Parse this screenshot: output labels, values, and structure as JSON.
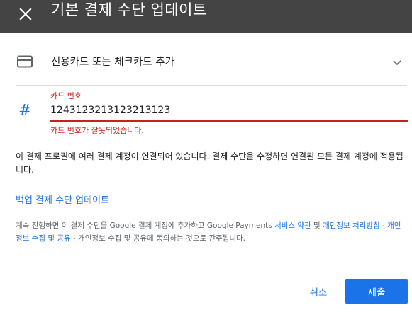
{
  "header": {
    "title": "기본 결제 수단 업데이트",
    "close_icon": "close-icon"
  },
  "payment_method": {
    "label": "신용카드 또는 체크카드 추가",
    "icon": "credit-card-icon",
    "chevron_icon": "chevron-down-icon"
  },
  "card_number": {
    "label": "카드 번호",
    "value": "1243123213123213123",
    "error": "카드 번호가 잘못되었습니다.",
    "icon": "hash-icon",
    "icon_glyph": "#"
  },
  "info_text": "이 결제 프로필에 여러 결제 계정이 연결되어 있습니다. 결제 수단을 수정하면 연결된 모든 결제 계정에 적용됩니다.",
  "backup_link": "백업 결제 수단 업데이트",
  "legal": {
    "part1": "계속 진행하면 이 결제 수단을 Google 결제 계정에 추가하고 Google Payments ",
    "link1": "서비스 약관",
    "part2": " 및 ",
    "link2": "개인정보 처리방침 - 개인정보 수집 및 공유",
    "part3": " - 개인정보 수집 및 공유에 동의하는 것으로 간주됩니다."
  },
  "actions": {
    "cancel": "취소",
    "submit": "제출"
  },
  "colors": {
    "header_bg": "#444444",
    "accent": "#1a73e8",
    "error": "#c5221f"
  }
}
